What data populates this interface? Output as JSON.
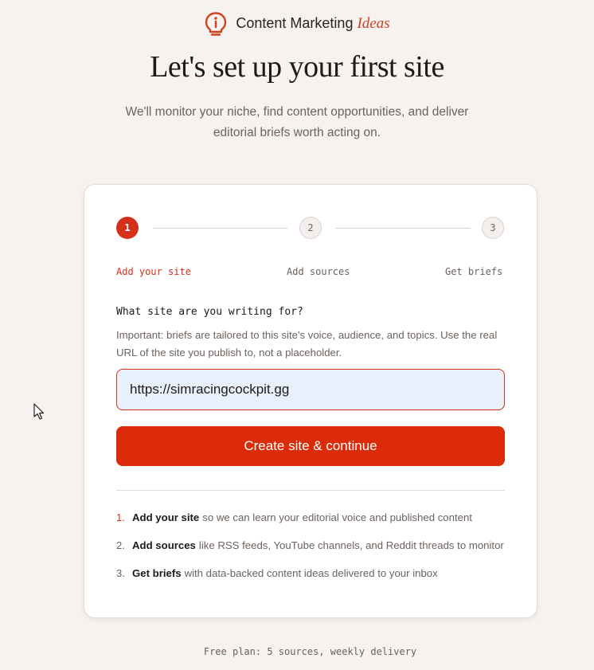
{
  "brand": {
    "name": "Content Marketing",
    "accent_word": "Ideas",
    "icon": "lightbulb-icon",
    "accent_color": "#d0401f"
  },
  "hero": {
    "title": "Let's set up your first site",
    "subtitle": "We'll monitor your niche, find content opportunities, and deliver editorial briefs worth acting on."
  },
  "stepper": {
    "steps": [
      {
        "number": "1",
        "label": "Add your site",
        "active": true
      },
      {
        "number": "2",
        "label": "Add sources",
        "active": false
      },
      {
        "number": "3",
        "label": "Get briefs",
        "active": false
      }
    ]
  },
  "form": {
    "question": "What site are you writing for?",
    "hint": "Important: briefs are tailored to this site's voice, audience, and topics. Use the real URL of the site you publish to, not a placeholder.",
    "url_value": "https://simracingcockpit.gg",
    "submit_label": "Create site & continue",
    "button_color": "#db2b08"
  },
  "how_it_works": [
    {
      "number": "1.",
      "strong": "Add your site",
      "text": "so we can learn your editorial voice and published content"
    },
    {
      "number": "2.",
      "strong": "Add sources",
      "text": "like RSS feeds, YouTube channels, and Reddit threads to monitor"
    },
    {
      "number": "3.",
      "strong": "Get briefs",
      "text": "with data-backed content ideas delivered to your inbox"
    }
  ],
  "footer": {
    "note": "Free plan: 5 sources, weekly delivery"
  }
}
